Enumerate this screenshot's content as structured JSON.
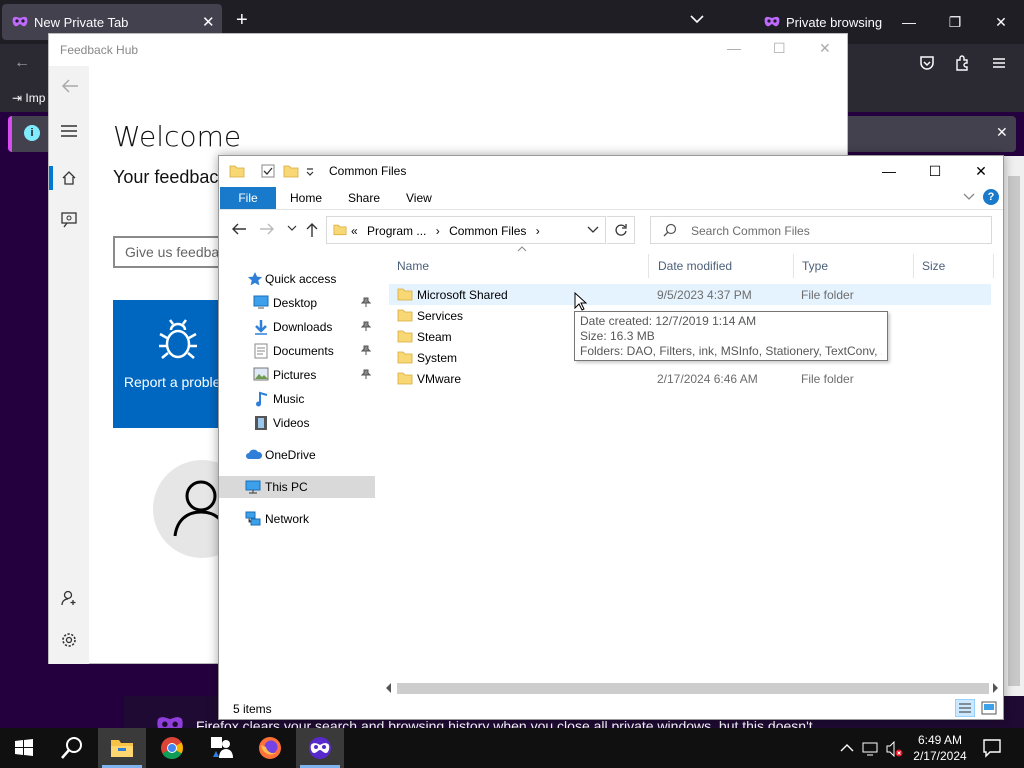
{
  "firefox": {
    "tab_title": "New Private Tab",
    "private_label": "Private browsing",
    "bookmark_import": "Imp",
    "bottom_message": "Firefox clears your search and browsing history when you close all private windows, but this doesn't"
  },
  "feedback_hub": {
    "window_title": "Feedback Hub",
    "welcome": "Welcome",
    "subtitle": "Your feedback",
    "input_placeholder": "Give us feedback",
    "report_label": "Report a problem"
  },
  "explorer": {
    "title": "Common Files",
    "ribbon": {
      "file": "File",
      "home": "Home",
      "share": "Share",
      "view": "View"
    },
    "address": {
      "overflow": "«",
      "crumb1": "Program ...",
      "crumb2": "Common Files"
    },
    "search_placeholder": "Search Common Files",
    "sidebar": {
      "quick_access": "Quick access",
      "desktop": "Desktop",
      "downloads": "Downloads",
      "documents": "Documents",
      "pictures": "Pictures",
      "music": "Music",
      "videos": "Videos",
      "onedrive": "OneDrive",
      "this_pc": "This PC",
      "network": "Network"
    },
    "columns": {
      "name": "Name",
      "date": "Date modified",
      "type": "Type",
      "size": "Size"
    },
    "files": [
      {
        "name": "Microsoft Shared",
        "date": "9/5/2023 4:37 PM",
        "type": "File folder"
      },
      {
        "name": "Services",
        "date": "",
        "type": ""
      },
      {
        "name": "Steam",
        "date": "",
        "type": ""
      },
      {
        "name": "System",
        "date": "",
        "type": ""
      },
      {
        "name": "VMware",
        "date": "2/17/2024 6:46 AM",
        "type": "File folder"
      }
    ],
    "tooltip": {
      "created": "Date created: 12/7/2019 1:14 AM",
      "size": "Size: 16.3 MB",
      "folders": "Folders: DAO, Filters, ink, MSInfo, Stationery, TextConv, ..."
    },
    "status": "5 items"
  },
  "taskbar": {
    "time": "6:49 AM",
    "date": "2/17/2024"
  },
  "colors": {
    "accent_blue": "#1979ca",
    "firefox_private_purple": "#25003e",
    "folder_yellow": "#f8d775"
  }
}
